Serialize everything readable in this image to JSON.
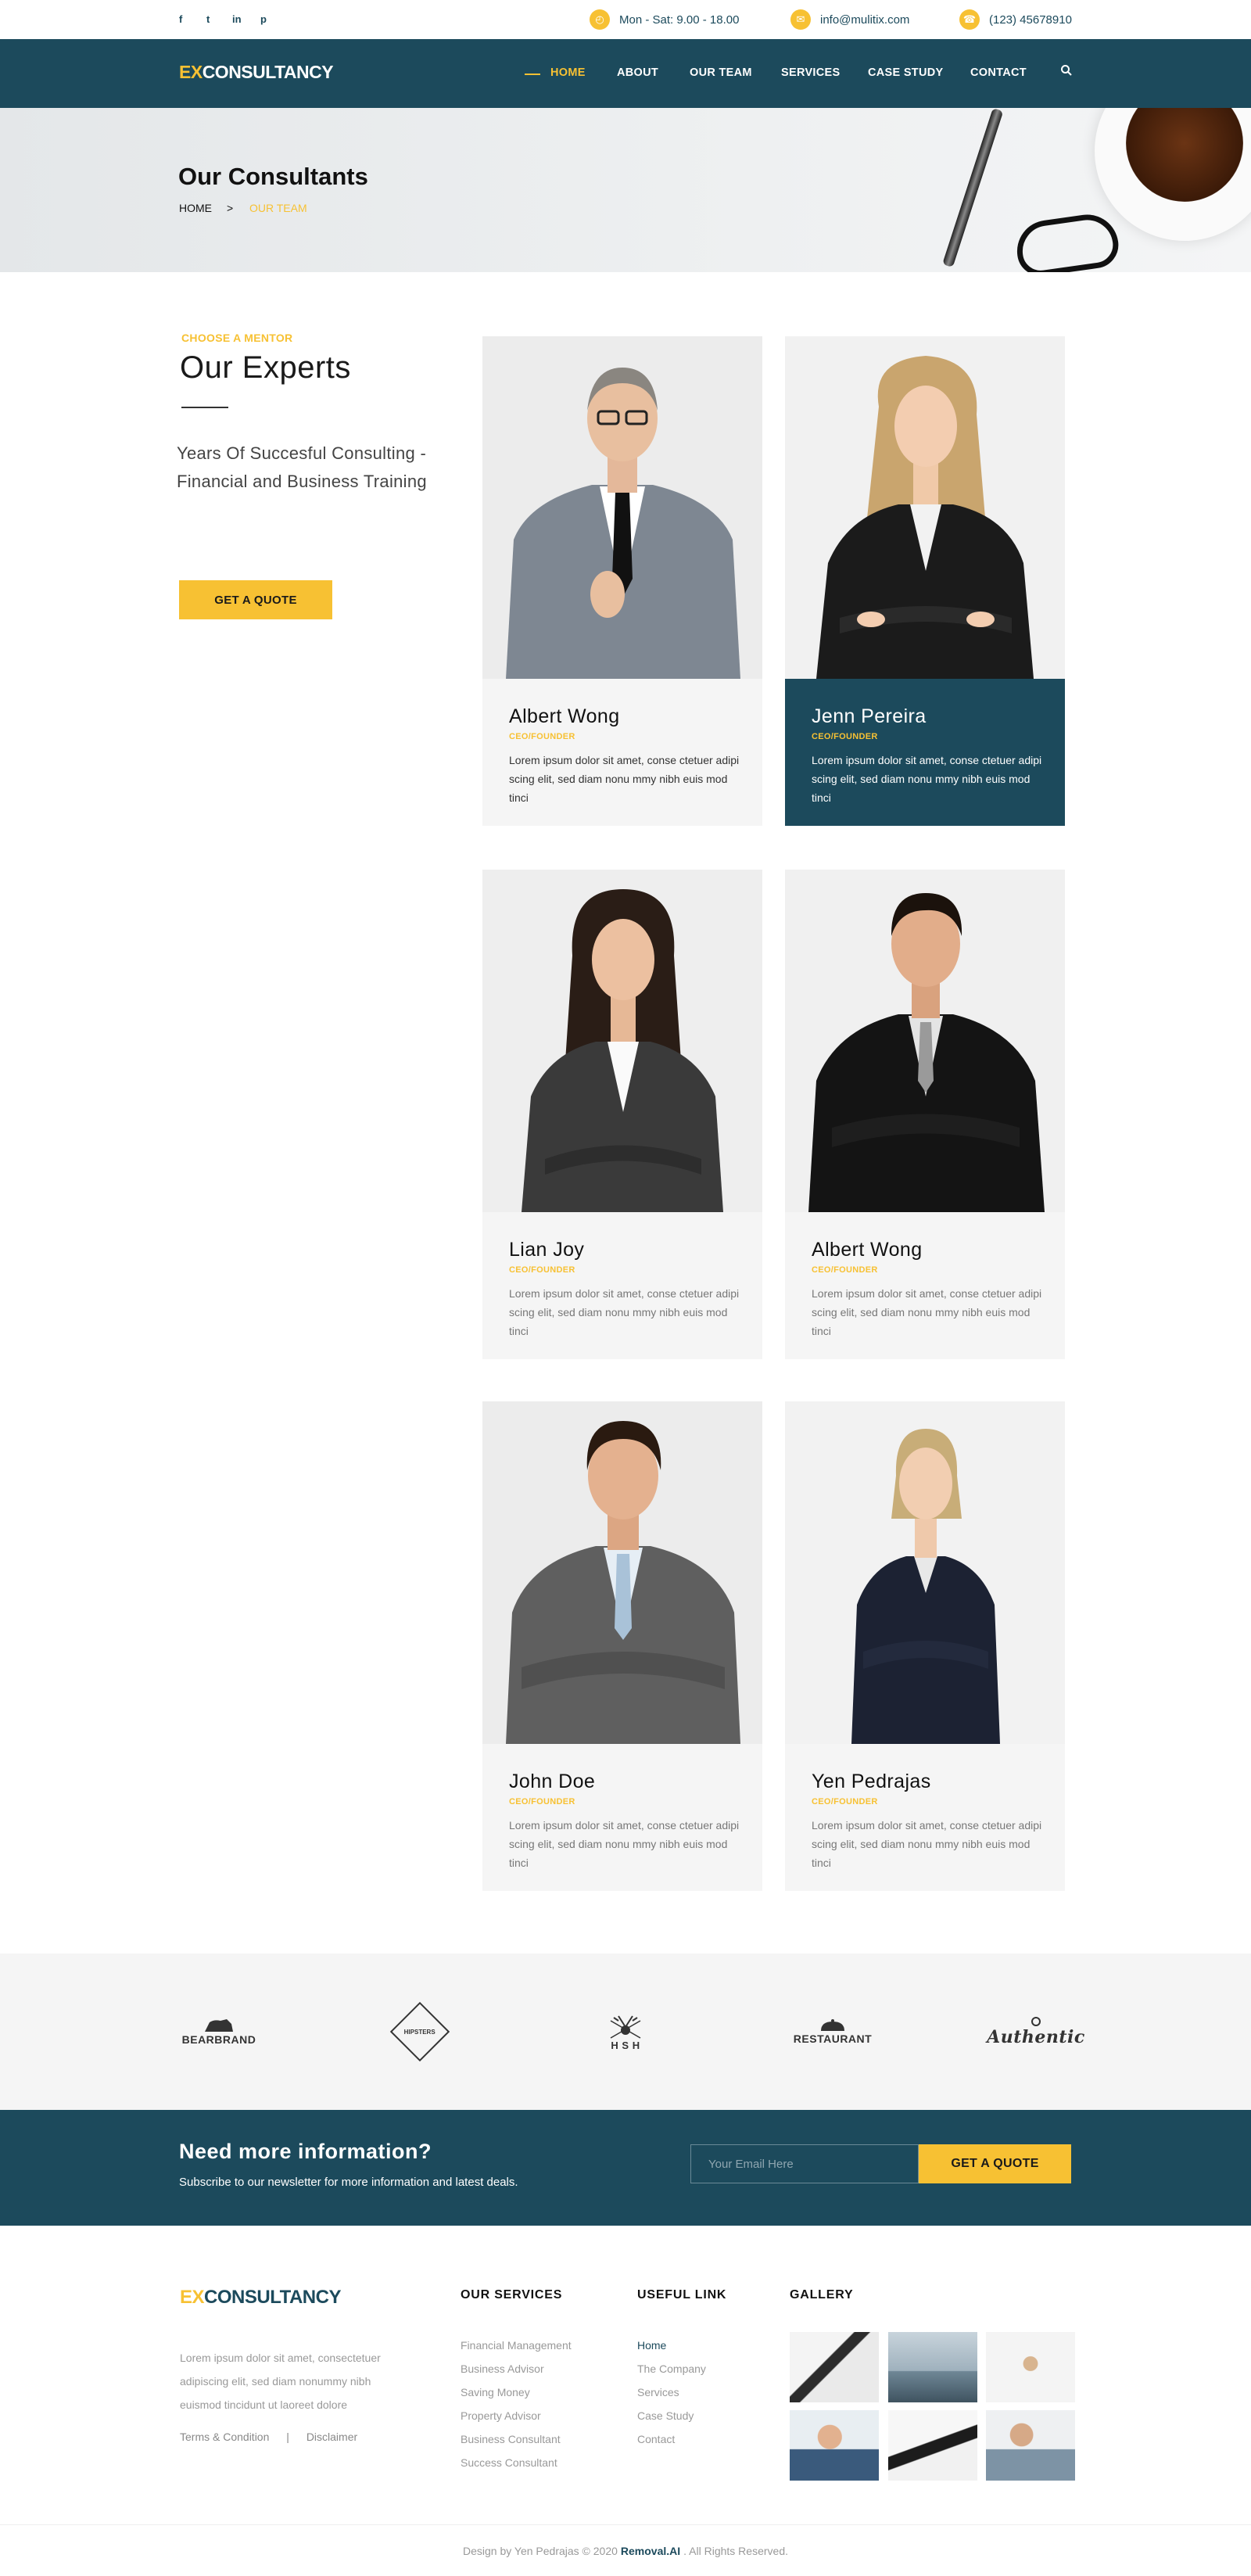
{
  "topbar": {
    "social": [
      "f",
      "t",
      "in",
      "p"
    ],
    "hours": "Mon - Sat: 9.00 - 18.00",
    "email": "info@mulitix.com",
    "phone": "(123) 45678910"
  },
  "brand": {
    "prefix": "EX",
    "name": "CONSULTANCY"
  },
  "nav": {
    "items": [
      "HOME",
      "ABOUT",
      "OUR TEAM",
      "SERVICES",
      "CASE STUDY",
      "CONTACT"
    ],
    "active": "HOME"
  },
  "page_header": {
    "title": "Our Consultants",
    "crumb_home": "HOME",
    "crumb_sep": ">",
    "crumb_current": "OUR TEAM"
  },
  "intro": {
    "kicker": "CHOOSE A MENTOR",
    "title": "Our Experts",
    "lead": "Years Of Succesful Consulting - Financial and Business Training",
    "button": "GET A QUOTE"
  },
  "team": [
    {
      "name": "Albert Wong",
      "role": "CEO/FOUNDER",
      "desc": "Lorem ipsum dolor sit amet, conse ctetuer adipi scing elit, sed diam nonu mmy nibh euis mod tinci"
    },
    {
      "name": "Jenn Pereira",
      "role": "CEO/FOUNDER",
      "desc": "Lorem ipsum dolor sit amet, conse ctetuer adipi scing elit, sed diam nonu mmy nibh euis mod tinci"
    },
    {
      "name": "Lian Joy",
      "role": "CEO/FOUNDER",
      "desc": "Lorem ipsum dolor sit amet, conse ctetuer adipi scing elit, sed diam nonu mmy nibh euis mod tinci"
    },
    {
      "name": "Albert Wong",
      "role": "CEO/FOUNDER",
      "desc": "Lorem ipsum dolor sit amet, conse ctetuer adipi scing elit, sed diam nonu mmy nibh euis mod tinci"
    },
    {
      "name": "John Doe",
      "role": "CEO/FOUNDER",
      "desc": "Lorem ipsum dolor sit amet, conse ctetuer adipi scing elit, sed diam nonu mmy nibh euis mod tinci"
    },
    {
      "name": "Yen Pedrajas",
      "role": "CEO/FOUNDER",
      "desc": "Lorem ipsum dolor sit amet, conse ctetuer adipi scing elit, sed diam nonu mmy nibh euis mod tinci"
    }
  ],
  "brands": [
    "BEARBRAND",
    "HIPSTERS",
    "H S H",
    "RESTAURANT",
    "Authentic"
  ],
  "newsletter": {
    "title": "Need more information?",
    "subtitle": "Subscribe to our newsletter for more information and latest deals.",
    "placeholder": "Your Email Here",
    "button": "GET A QUOTE"
  },
  "footer": {
    "about": "Lorem ipsum dolor sit amet, consectetuer adipiscing elit, sed diam nonummy nibh euismod tincidunt ut laoreet dolore",
    "terms": "Terms & Condition",
    "legal_sep": "|",
    "disclaimer": "Disclaimer",
    "services_title": "OUR SERVICES",
    "services": [
      "Financial Management",
      "Business Advisor",
      "Saving Money",
      "Property Advisor",
      "Business Consultant",
      "Success Consultant"
    ],
    "links_title": "USEFUL LINK",
    "links": [
      "Home",
      "The Company",
      "Services",
      "Case Study",
      "Contact"
    ],
    "gallery_title": "GALLERY",
    "copyright_pre": "Design by Yen Pedrajas © 2020",
    "copyright_brand": "Removal.AI",
    "copyright_post": ". All Rights Reserved."
  },
  "colors": {
    "primary": "#1c4a5c",
    "accent": "#f7c133"
  }
}
